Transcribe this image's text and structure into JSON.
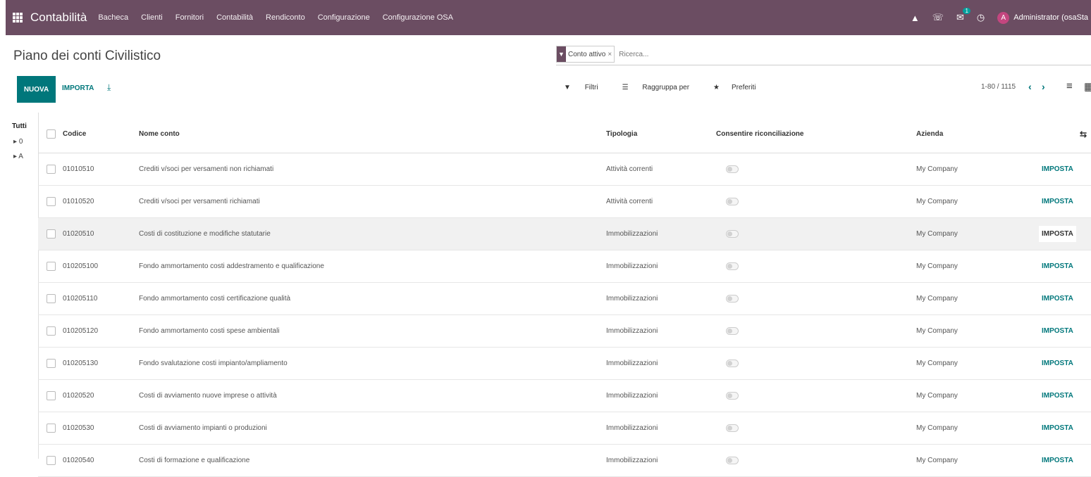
{
  "navbar": {
    "app_name": "Contabilità",
    "menu": [
      "Bacheca",
      "Clienti",
      "Fornitori",
      "Contabilità",
      "Rendiconto",
      "Configurazione",
      "Configurazione OSA"
    ],
    "chat_badge": "1",
    "avatar_letter": "A",
    "user_name": "Administrator (osaSta"
  },
  "control_panel": {
    "breadcrumb": "Piano dei conti Civilistico",
    "facet": "Conto attivo",
    "facet_remove": "×",
    "search_placeholder": "Ricerca...",
    "new_label": "NUOVA",
    "import_label": "IMPORTA",
    "filters_label": "Filtri",
    "group_label": "Raggruppa per",
    "favorites_label": "Preferiti",
    "pager": "1-80 / 1115"
  },
  "side_panel": {
    "all_label": "Tutti",
    "groups": [
      "0",
      "A"
    ]
  },
  "table": {
    "columns": [
      "Codice",
      "Nome conto",
      "Tipologia",
      "Consentire riconciliazione",
      "Azienda"
    ],
    "action_label": "IMPOSTA",
    "rows": [
      {
        "code": "01010510",
        "name": "Crediti v/soci per versamenti non richiamati",
        "type": "Attività correnti",
        "company": "My Company"
      },
      {
        "code": "01010520",
        "name": "Crediti v/soci per versamenti richiamati",
        "type": "Attività correnti",
        "company": "My Company"
      },
      {
        "code": "01020510",
        "name": "Costi di costituzione e modifiche statutarie",
        "type": "Immobilizzazioni",
        "company": "My Company"
      },
      {
        "code": "010205100",
        "name": "Fondo ammortamento costi addestramento e qualificazione",
        "type": "Immobilizzazioni",
        "company": "My Company"
      },
      {
        "code": "010205110",
        "name": "Fondo ammortamento costi certificazione qualità",
        "type": "Immobilizzazioni",
        "company": "My Company"
      },
      {
        "code": "010205120",
        "name": "Fondo ammortamento costi spese ambientali",
        "type": "Immobilizzazioni",
        "company": "My Company"
      },
      {
        "code": "010205130",
        "name": "Fondo svalutazione costi impianto/ampliamento",
        "type": "Immobilizzazioni",
        "company": "My Company"
      },
      {
        "code": "01020520",
        "name": "Costi di avviamento nuove imprese o attività",
        "type": "Immobilizzazioni",
        "company": "My Company"
      },
      {
        "code": "01020530",
        "name": "Costi di avviamento impianti o produzioni",
        "type": "Immobilizzazioni",
        "company": "My Company"
      },
      {
        "code": "01020540",
        "name": "Costi di formazione e qualificazione",
        "type": "Immobilizzazioni",
        "company": "My Company"
      }
    ]
  },
  "colors": {
    "navbar": "#6b4d62",
    "primary": "#00777b",
    "badge": "#00a09d",
    "avatar": "#c3467f"
  }
}
